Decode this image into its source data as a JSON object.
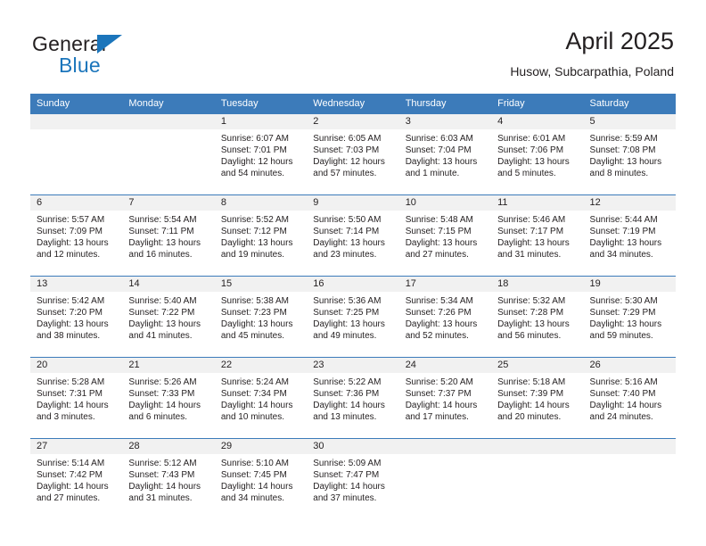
{
  "brand": {
    "name_top": "General",
    "name_bottom": "Blue",
    "triangle_icon": "triangle-icon",
    "color_dark": "#231f20",
    "color_blue": "#1b75bb"
  },
  "header": {
    "title": "April 2025",
    "subtitle": "Husow, Subcarpathia, Poland"
  },
  "theme": {
    "header_blue": "#3c7bba",
    "row_band_gray": "#f1f1f1",
    "text": "#231f20"
  },
  "weekdays": [
    "Sunday",
    "Monday",
    "Tuesday",
    "Wednesday",
    "Thursday",
    "Friday",
    "Saturday"
  ],
  "weeks": [
    [
      {
        "day": "",
        "lines": [
          "",
          "",
          "",
          ""
        ]
      },
      {
        "day": "",
        "lines": [
          "",
          "",
          "",
          ""
        ]
      },
      {
        "day": "1",
        "lines": [
          "Sunrise: 6:07 AM",
          "Sunset: 7:01 PM",
          "Daylight: 12 hours",
          "and 54 minutes."
        ]
      },
      {
        "day": "2",
        "lines": [
          "Sunrise: 6:05 AM",
          "Sunset: 7:03 PM",
          "Daylight: 12 hours",
          "and 57 minutes."
        ]
      },
      {
        "day": "3",
        "lines": [
          "Sunrise: 6:03 AM",
          "Sunset: 7:04 PM",
          "Daylight: 13 hours",
          "and 1 minute."
        ]
      },
      {
        "day": "4",
        "lines": [
          "Sunrise: 6:01 AM",
          "Sunset: 7:06 PM",
          "Daylight: 13 hours",
          "and 5 minutes."
        ]
      },
      {
        "day": "5",
        "lines": [
          "Sunrise: 5:59 AM",
          "Sunset: 7:08 PM",
          "Daylight: 13 hours",
          "and 8 minutes."
        ]
      }
    ],
    [
      {
        "day": "6",
        "lines": [
          "Sunrise: 5:57 AM",
          "Sunset: 7:09 PM",
          "Daylight: 13 hours",
          "and 12 minutes."
        ]
      },
      {
        "day": "7",
        "lines": [
          "Sunrise: 5:54 AM",
          "Sunset: 7:11 PM",
          "Daylight: 13 hours",
          "and 16 minutes."
        ]
      },
      {
        "day": "8",
        "lines": [
          "Sunrise: 5:52 AM",
          "Sunset: 7:12 PM",
          "Daylight: 13 hours",
          "and 19 minutes."
        ]
      },
      {
        "day": "9",
        "lines": [
          "Sunrise: 5:50 AM",
          "Sunset: 7:14 PM",
          "Daylight: 13 hours",
          "and 23 minutes."
        ]
      },
      {
        "day": "10",
        "lines": [
          "Sunrise: 5:48 AM",
          "Sunset: 7:15 PM",
          "Daylight: 13 hours",
          "and 27 minutes."
        ]
      },
      {
        "day": "11",
        "lines": [
          "Sunrise: 5:46 AM",
          "Sunset: 7:17 PM",
          "Daylight: 13 hours",
          "and 31 minutes."
        ]
      },
      {
        "day": "12",
        "lines": [
          "Sunrise: 5:44 AM",
          "Sunset: 7:19 PM",
          "Daylight: 13 hours",
          "and 34 minutes."
        ]
      }
    ],
    [
      {
        "day": "13",
        "lines": [
          "Sunrise: 5:42 AM",
          "Sunset: 7:20 PM",
          "Daylight: 13 hours",
          "and 38 minutes."
        ]
      },
      {
        "day": "14",
        "lines": [
          "Sunrise: 5:40 AM",
          "Sunset: 7:22 PM",
          "Daylight: 13 hours",
          "and 41 minutes."
        ]
      },
      {
        "day": "15",
        "lines": [
          "Sunrise: 5:38 AM",
          "Sunset: 7:23 PM",
          "Daylight: 13 hours",
          "and 45 minutes."
        ]
      },
      {
        "day": "16",
        "lines": [
          "Sunrise: 5:36 AM",
          "Sunset: 7:25 PM",
          "Daylight: 13 hours",
          "and 49 minutes."
        ]
      },
      {
        "day": "17",
        "lines": [
          "Sunrise: 5:34 AM",
          "Sunset: 7:26 PM",
          "Daylight: 13 hours",
          "and 52 minutes."
        ]
      },
      {
        "day": "18",
        "lines": [
          "Sunrise: 5:32 AM",
          "Sunset: 7:28 PM",
          "Daylight: 13 hours",
          "and 56 minutes."
        ]
      },
      {
        "day": "19",
        "lines": [
          "Sunrise: 5:30 AM",
          "Sunset: 7:29 PM",
          "Daylight: 13 hours",
          "and 59 minutes."
        ]
      }
    ],
    [
      {
        "day": "20",
        "lines": [
          "Sunrise: 5:28 AM",
          "Sunset: 7:31 PM",
          "Daylight: 14 hours",
          "and 3 minutes."
        ]
      },
      {
        "day": "21",
        "lines": [
          "Sunrise: 5:26 AM",
          "Sunset: 7:33 PM",
          "Daylight: 14 hours",
          "and 6 minutes."
        ]
      },
      {
        "day": "22",
        "lines": [
          "Sunrise: 5:24 AM",
          "Sunset: 7:34 PM",
          "Daylight: 14 hours",
          "and 10 minutes."
        ]
      },
      {
        "day": "23",
        "lines": [
          "Sunrise: 5:22 AM",
          "Sunset: 7:36 PM",
          "Daylight: 14 hours",
          "and 13 minutes."
        ]
      },
      {
        "day": "24",
        "lines": [
          "Sunrise: 5:20 AM",
          "Sunset: 7:37 PM",
          "Daylight: 14 hours",
          "and 17 minutes."
        ]
      },
      {
        "day": "25",
        "lines": [
          "Sunrise: 5:18 AM",
          "Sunset: 7:39 PM",
          "Daylight: 14 hours",
          "and 20 minutes."
        ]
      },
      {
        "day": "26",
        "lines": [
          "Sunrise: 5:16 AM",
          "Sunset: 7:40 PM",
          "Daylight: 14 hours",
          "and 24 minutes."
        ]
      }
    ],
    [
      {
        "day": "27",
        "lines": [
          "Sunrise: 5:14 AM",
          "Sunset: 7:42 PM",
          "Daylight: 14 hours",
          "and 27 minutes."
        ]
      },
      {
        "day": "28",
        "lines": [
          "Sunrise: 5:12 AM",
          "Sunset: 7:43 PM",
          "Daylight: 14 hours",
          "and 31 minutes."
        ]
      },
      {
        "day": "29",
        "lines": [
          "Sunrise: 5:10 AM",
          "Sunset: 7:45 PM",
          "Daylight: 14 hours",
          "and 34 minutes."
        ]
      },
      {
        "day": "30",
        "lines": [
          "Sunrise: 5:09 AM",
          "Sunset: 7:47 PM",
          "Daylight: 14 hours",
          "and 37 minutes."
        ]
      },
      {
        "day": "",
        "lines": [
          "",
          "",
          "",
          ""
        ]
      },
      {
        "day": "",
        "lines": [
          "",
          "",
          "",
          ""
        ]
      },
      {
        "day": "",
        "lines": [
          "",
          "",
          "",
          ""
        ]
      }
    ]
  ]
}
